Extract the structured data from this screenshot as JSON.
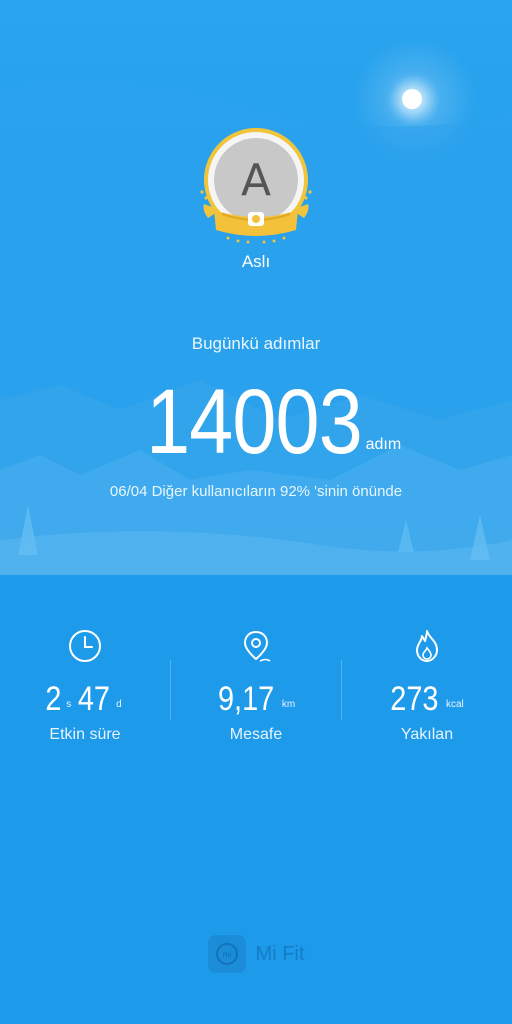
{
  "profile": {
    "avatar_letter": "A",
    "name": "Aslı"
  },
  "steps": {
    "label": "Bugünkü adımlar",
    "value": "14003",
    "unit": "adım"
  },
  "rank": {
    "text": "06/04 Diğer kullanıcıların 92% 'sinin önünde"
  },
  "stats": {
    "active_time": {
      "icon": "clock-icon",
      "hours": "2",
      "hours_unit": "s",
      "minutes": "47",
      "minutes_unit": "d",
      "label": "Etkin süre"
    },
    "distance": {
      "icon": "location-pin-icon",
      "value": "9,17",
      "unit": "km",
      "label": "Mesafe"
    },
    "calories": {
      "icon": "flame-icon",
      "value": "273",
      "unit": "kcal",
      "label": "Yakılan"
    }
  },
  "brand": {
    "name": "Mi Fit",
    "logo_text": "mi"
  },
  "colors": {
    "background": "#1e9aea",
    "accent_gold": "#f1c53b",
    "text": "#ffffff"
  }
}
